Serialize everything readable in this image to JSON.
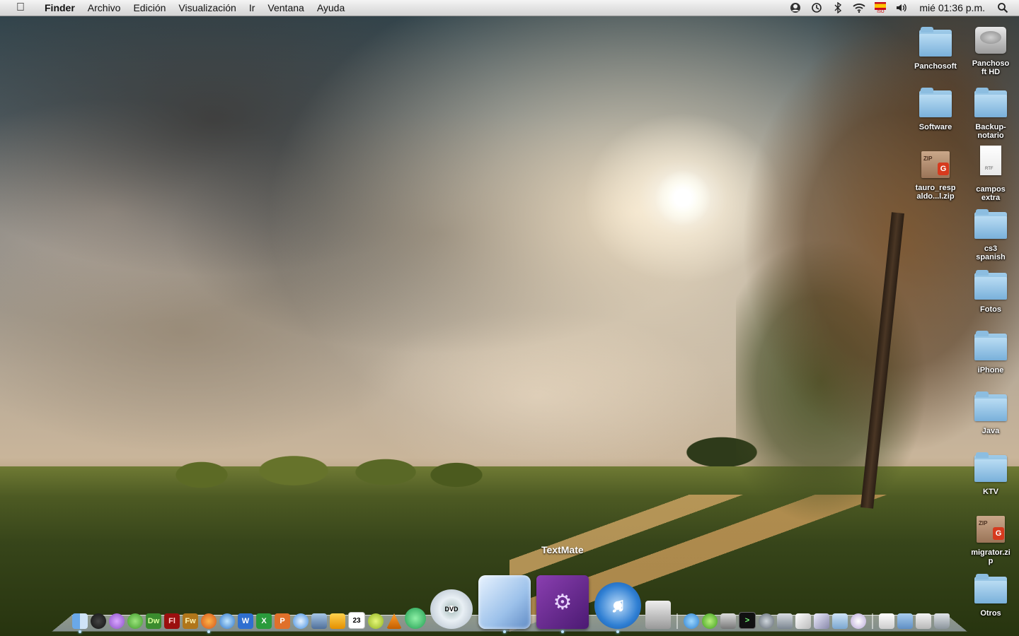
{
  "menubar": {
    "apple_icon": "apple-icon",
    "items": [
      "Finder",
      "Archivo",
      "Edición",
      "Visualización",
      "Ir",
      "Ventana",
      "Ayuda"
    ],
    "status_icons": [
      "user-icon",
      "time-machine-icon",
      "bluetooth-icon",
      "wifi-icon",
      "flag-icon",
      "volume-icon"
    ],
    "flag_label": "ISO",
    "clock": "mié 01:36 p.m.",
    "spotlight_icon": "spotlight-search-icon"
  },
  "desktop": {
    "icons": [
      {
        "label": "Panchosoft",
        "type": "folder"
      },
      {
        "label": "Panchosoft HD",
        "type": "hard-drive"
      },
      {
        "label": "Software",
        "type": "folder"
      },
      {
        "label": "Backup-notario",
        "type": "folder"
      },
      {
        "label": "tauro_respaldo...l.zip",
        "type": "zip"
      },
      {
        "label": "campos extra",
        "type": "rtf"
      },
      {
        "label": "cs3 spanish",
        "type": "folder"
      },
      {
        "label": "Fotos",
        "type": "folder"
      },
      {
        "label": "iPhone",
        "type": "folder"
      },
      {
        "label": "Java",
        "type": "folder"
      },
      {
        "label": "KTV",
        "type": "folder"
      },
      {
        "label": "migrator.zip",
        "type": "zip"
      },
      {
        "label": "Otros",
        "type": "folder"
      }
    ],
    "zip_tag": "ZIP",
    "rtf_tag": "RTF"
  },
  "dock": {
    "tooltip": "TextMate",
    "small_left": [
      "finder-icon",
      "dashboard-icon",
      "itunes-plugin-icon",
      "leaf-icon",
      "Dw",
      "Fl",
      "Fw",
      "firefox-icon",
      "safari-icon",
      "word-icon",
      "excel-icon",
      "powerpoint-icon",
      "ichat-icon",
      "deliveries-icon",
      "mail-icon",
      "ical-icon",
      "lime-icon",
      "vlc-icon",
      "x-icon"
    ],
    "ical_date": "23",
    "dvd_label": "DVD",
    "medium": [
      "dvd-player-icon",
      "cube-app-icon",
      "textmate-icon",
      "itunes-icon"
    ],
    "small_right": [
      "xcode-icon",
      "adium-icon",
      "growl-icon",
      "script-icon",
      "terminal-icon",
      "system-pref-icon",
      "preview-icon",
      "photo-icon",
      "applications-icon",
      "documents-icon",
      "download-folder-icon",
      "downloads-icon",
      "grid-icon",
      "trash-icon"
    ]
  }
}
